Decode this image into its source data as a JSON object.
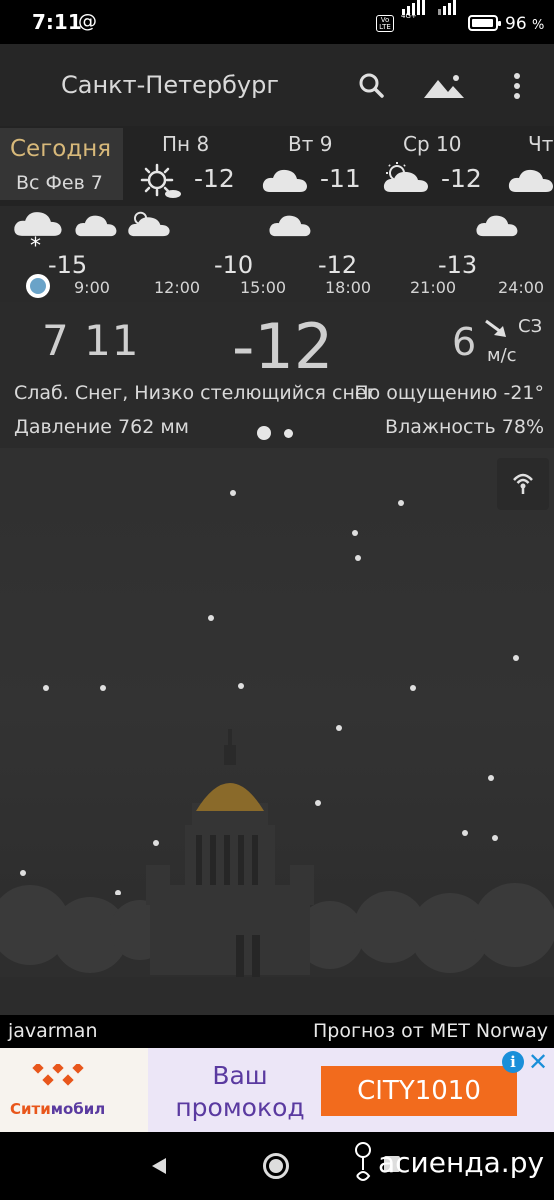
{
  "status": {
    "time": "7:11",
    "at": "@",
    "volte": "Vo LTE",
    "network": "4G+",
    "battery_pct": "96",
    "battery_suffix": "%",
    "battery_level": 0.96
  },
  "appbar": {
    "city": "Санкт-Петербург",
    "icons": [
      "search-icon",
      "landscape-icon",
      "more-vert-icon"
    ]
  },
  "days": {
    "today_label": "Сегодня",
    "today_date": "Вс Фев 7",
    "items": [
      {
        "name": "Пн 8",
        "temp": "-12",
        "icon": "sun-cloud-icon"
      },
      {
        "name": "Вт 9",
        "temp": "-11",
        "icon": "cloud-icon"
      },
      {
        "name": "Ср 10",
        "temp": "-12",
        "icon": "partly-cloudy-icon"
      },
      {
        "name": "Чт",
        "temp": "",
        "icon": "cloud-icon"
      }
    ]
  },
  "hourly": {
    "temps": [
      "-15",
      "-10",
      "-12",
      "-13"
    ],
    "times": [
      "9:00",
      "12:00",
      "15:00",
      "18:00",
      "21:00",
      "24:00"
    ]
  },
  "current": {
    "time": "7 11",
    "temp": "-12",
    "wind_speed": "6",
    "wind_dir": "СЗ",
    "wind_unit": "м/с",
    "description": "Слаб. Снег, Низко стелющийся снег",
    "feels_like": "По ощущению -21°",
    "pressure": "Давление 762 мм",
    "humidity": "Влажность 78%",
    "page_dots": 2,
    "active_page": 0
  },
  "footer": {
    "author": "javarman",
    "provider": "Прогноз от MET Norway"
  },
  "ad": {
    "brand_part1": "Сити",
    "brand_part2": "мобил",
    "text": "Ваш промокод",
    "promo_code": "CITY1010",
    "info": "i",
    "close": "✕",
    "colors": {
      "orange": "#f26b1d",
      "purple": "#5a3aa0"
    }
  },
  "navbar": {
    "watermark": "асиенда.ру"
  }
}
